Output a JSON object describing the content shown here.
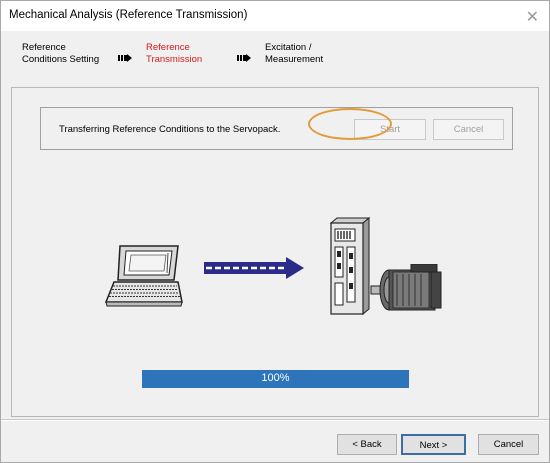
{
  "window": {
    "title": "Mechanical Analysis (Reference Transmission)",
    "close_glyph": "✕"
  },
  "steps": [
    {
      "line1": "Reference",
      "line2": "Conditions Setting",
      "active": false
    },
    {
      "line1": "Reference",
      "line2": "Transmission",
      "active": true
    },
    {
      "line1": "Excitation /",
      "line2": "Measurement",
      "active": false
    }
  ],
  "message": {
    "text": "Transferring Reference Conditions to the Servopack.",
    "start_label": "Start",
    "cancel_label": "Cancel"
  },
  "progress": {
    "value": 1.0,
    "label": "100%",
    "color": "#2d74ba"
  },
  "footer": {
    "back_label": "< Back",
    "next_label": "Next >",
    "cancel_label": "Cancel"
  },
  "icons": [
    "laptop-icon",
    "transfer-arrow-icon",
    "servopack-icon",
    "servomotor-icon"
  ],
  "colors": {
    "active_step": "#d41c1c",
    "highlight": "#e39a3b",
    "arrow": "#2b2b8a"
  }
}
